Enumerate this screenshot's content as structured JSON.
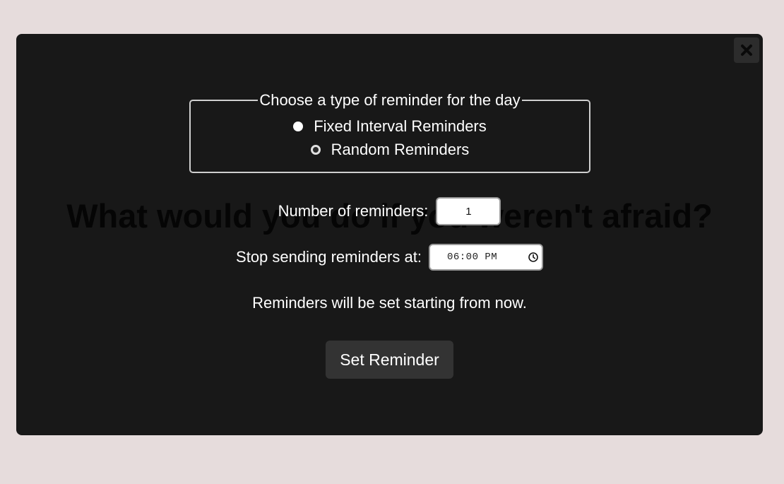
{
  "background_quote": "What would you do if you weren't afraid?",
  "modal": {
    "close_icon": "close-icon",
    "reminder_type": {
      "legend": "Choose a type of reminder for the day",
      "options": [
        {
          "label": "Fixed Interval Reminders",
          "selected": false
        },
        {
          "label": "Random Reminders",
          "selected": true
        }
      ]
    },
    "number_of_reminders": {
      "label": "Number of reminders:",
      "value": "1"
    },
    "stop_time": {
      "label": "Stop sending reminders at:",
      "value": "06:00 PM",
      "icon": "clock-icon"
    },
    "info_text": "Reminders will be set starting from now.",
    "submit_label": "Set Reminder"
  }
}
